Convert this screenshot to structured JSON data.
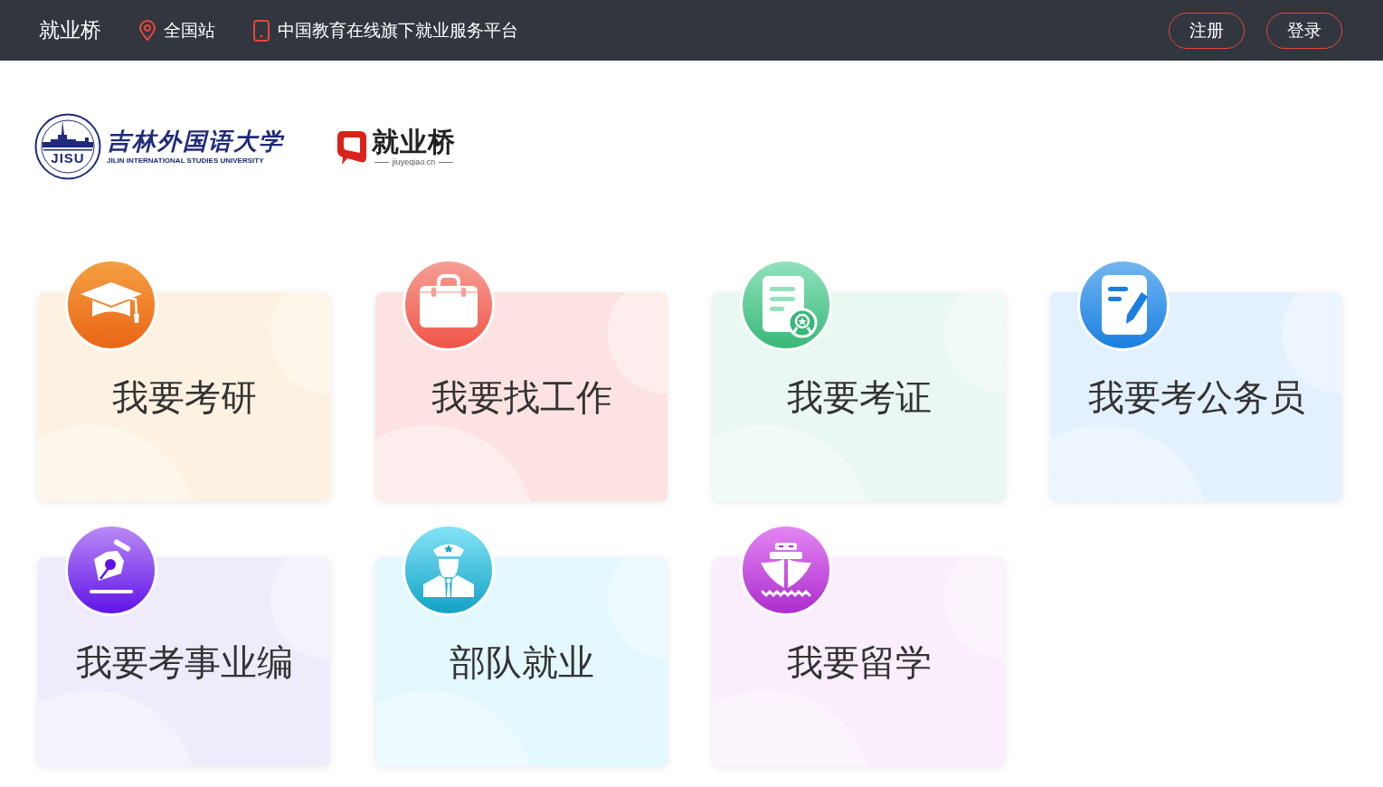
{
  "header": {
    "brand": "就业桥",
    "location": "全国站",
    "tagline": "中国教育在线旗下就业服务平台",
    "buttons": [
      {
        "label": "注册"
      },
      {
        "label": "登录"
      }
    ]
  },
  "logos": {
    "university": {
      "abbr": "JISU",
      "name": "吉林外国语大学",
      "english": "JILIN INTERNATIONAL STUDIES UNIVERSITY"
    },
    "platform": {
      "name": "就业桥",
      "domain": "jiuyeqiao.cn"
    }
  },
  "services": [
    {
      "label": "我要考研",
      "kind": "graduate",
      "color": "#fdf2e1"
    },
    {
      "label": "我要找工作",
      "kind": "job",
      "color": "#fce3e1"
    },
    {
      "label": "我要考证",
      "kind": "certificate",
      "color": "#e9f8f1"
    },
    {
      "label": "我要考公务员",
      "kind": "civil",
      "color": "#e3f0fe"
    },
    {
      "label": "我要考事业编",
      "kind": "institution",
      "color": "#efebfb"
    },
    {
      "label": "部队就业",
      "kind": "military",
      "color": "#e3f8fd"
    },
    {
      "label": "我要留学",
      "kind": "abroad",
      "color": "#fbeefc"
    }
  ]
}
